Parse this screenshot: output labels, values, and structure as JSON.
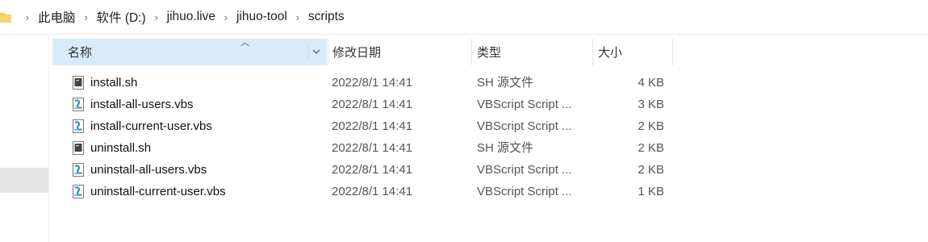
{
  "breadcrumb": {
    "items": [
      "此电脑",
      "软件 (D:)",
      "jihuo.live",
      "jihuo-tool",
      "scripts"
    ],
    "separator": "›"
  },
  "columns": {
    "name": "名称",
    "date": "修改日期",
    "type": "类型",
    "size": "大小"
  },
  "files": [
    {
      "name": "install.sh",
      "date": "2022/8/1 14:41",
      "type": "SH 源文件",
      "size": "4 KB",
      "icon": "sh-file-icon"
    },
    {
      "name": "install-all-users.vbs",
      "date": "2022/8/1 14:41",
      "type": "VBScript Script ...",
      "size": "3 KB",
      "icon": "vbs-file-icon"
    },
    {
      "name": "install-current-user.vbs",
      "date": "2022/8/1 14:41",
      "type": "VBScript Script ...",
      "size": "2 KB",
      "icon": "vbs-file-icon"
    },
    {
      "name": "uninstall.sh",
      "date": "2022/8/1 14:41",
      "type": "SH 源文件",
      "size": "2 KB",
      "icon": "sh-file-icon"
    },
    {
      "name": "uninstall-all-users.vbs",
      "date": "2022/8/1 14:41",
      "type": "VBScript Script ...",
      "size": "2 KB",
      "icon": "vbs-file-icon"
    },
    {
      "name": "uninstall-current-user.vbs",
      "date": "2022/8/1 14:41",
      "type": "VBScript Script ...",
      "size": "1 KB",
      "icon": "vbs-file-icon"
    }
  ],
  "colors": {
    "header_selected": "#d9ebf9",
    "folder": "#f4c94b",
    "vbs_icon": "#2a8a9a"
  }
}
